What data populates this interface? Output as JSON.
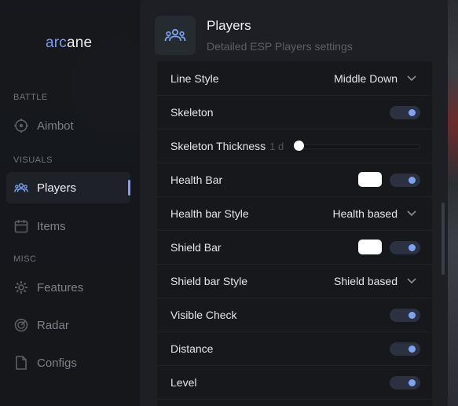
{
  "app": {
    "logo_part1": "arc",
    "logo_part2": "ane"
  },
  "sidebar": {
    "sections": [
      "BATTLE",
      "VISUALS",
      "MISC"
    ],
    "items": [
      {
        "label": "Aimbot",
        "icon": "crosshair-icon"
      },
      {
        "label": "Players",
        "icon": "players-icon",
        "active": true
      },
      {
        "label": "Items",
        "icon": "calendar-icon"
      },
      {
        "label": "Features",
        "icon": "gear-icon"
      },
      {
        "label": "Radar",
        "icon": "radar-icon"
      },
      {
        "label": "Configs",
        "icon": "file-icon"
      }
    ]
  },
  "header": {
    "title": "Players",
    "subtitle": "Detailed ESP Players settings",
    "icon": "players-icon"
  },
  "settings": [
    {
      "label": "Line Style",
      "type": "dropdown",
      "value": "Middle Down"
    },
    {
      "label": "Skeleton",
      "type": "toggle",
      "on": true
    },
    {
      "label": "Skeleton Thickness",
      "hint": "1 d",
      "type": "slider",
      "value": 0
    },
    {
      "label": "Health Bar",
      "type": "color-toggle",
      "color": "#ffffff",
      "on": true
    },
    {
      "label": "Health bar Style",
      "type": "dropdown",
      "value": "Health based"
    },
    {
      "label": "Shield Bar",
      "type": "color-toggle",
      "color": "#ffffff",
      "on": true
    },
    {
      "label": "Shield bar Style",
      "type": "dropdown",
      "value": "Shield based"
    },
    {
      "label": "Visible Check",
      "type": "toggle",
      "on": true
    },
    {
      "label": "Distance",
      "type": "toggle",
      "on": true
    },
    {
      "label": "Level",
      "type": "toggle",
      "on": true
    }
  ],
  "colors": {
    "accent": "#7ea3f2",
    "toggle_track": "#2b3140",
    "panel": "#1d1f24"
  }
}
